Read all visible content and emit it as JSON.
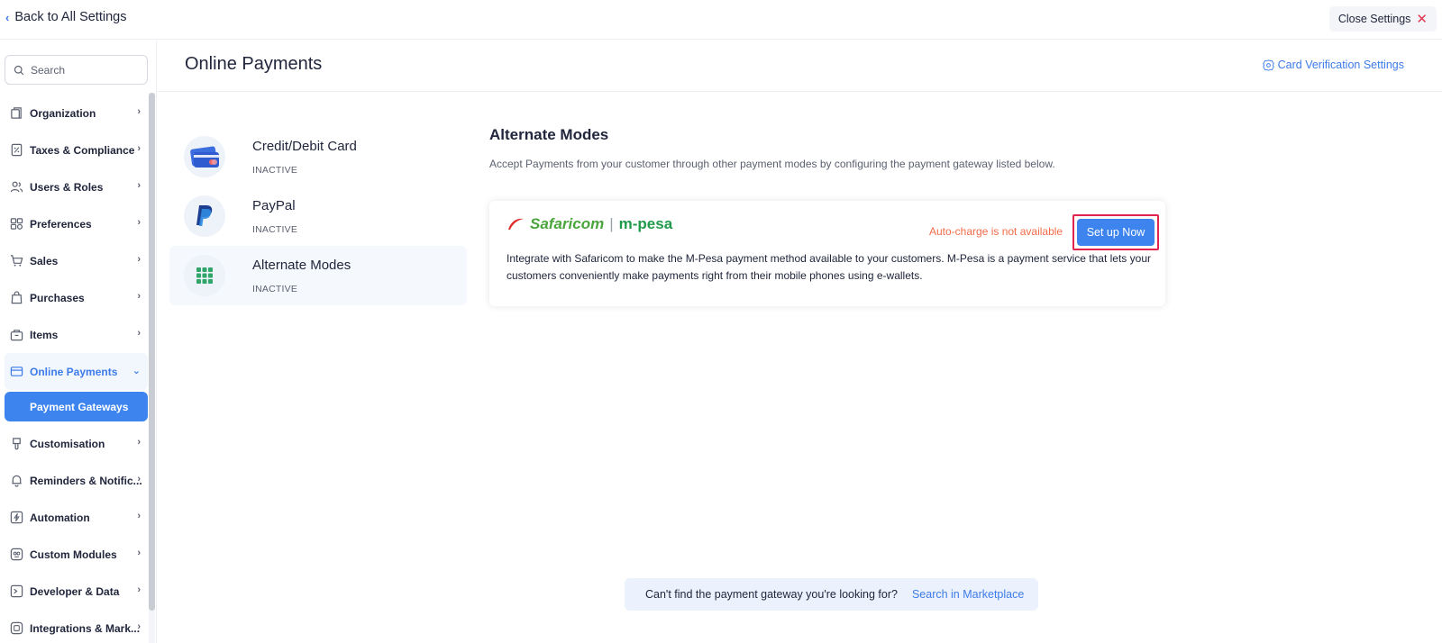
{
  "topbar": {
    "back_label": "Back to All Settings",
    "close_label": "Close Settings"
  },
  "sidebar": {
    "search_placeholder": "Search",
    "items": [
      {
        "label": "Organization",
        "icon": "building-icon"
      },
      {
        "label": "Taxes & Compliance",
        "icon": "tax-document-icon"
      },
      {
        "label": "Users & Roles",
        "icon": "users-icon"
      },
      {
        "label": "Preferences",
        "icon": "preferences-icon"
      },
      {
        "label": "Sales",
        "icon": "cart-icon"
      },
      {
        "label": "Purchases",
        "icon": "shopping-bag-icon"
      },
      {
        "label": "Items",
        "icon": "basket-icon"
      },
      {
        "label": "Online Payments",
        "icon": "card-icon",
        "active": true
      },
      {
        "label": "Customisation",
        "icon": "brush-icon"
      },
      {
        "label": "Reminders & Notific...",
        "icon": "bell-icon"
      },
      {
        "label": "Automation",
        "icon": "lightning-icon"
      },
      {
        "label": "Custom Modules",
        "icon": "custom-module-icon"
      },
      {
        "label": "Developer & Data",
        "icon": "code-icon"
      },
      {
        "label": "Integrations & Mark...",
        "icon": "integrations-icon"
      }
    ],
    "sub_item": "Payment Gateways"
  },
  "header": {
    "title": "Online Payments",
    "card_verification": "Card Verification Settings"
  },
  "modes": [
    {
      "name": "Credit/Debit Card",
      "status": "INACTIVE",
      "icon": "credit-card-icon"
    },
    {
      "name": "PayPal",
      "status": "INACTIVE",
      "icon": "paypal-icon"
    },
    {
      "name": "Alternate Modes",
      "status": "INACTIVE",
      "icon": "grid-icon",
      "active": true
    }
  ],
  "content": {
    "heading": "Alternate Modes",
    "description": "Accept Payments from your customer through other payment modes by configuring the payment gateway listed below.",
    "gateway": {
      "logo_text_1": "Safaricom",
      "logo_text_2": "m-pesa",
      "autocharge": "Auto-charge is not available",
      "setup_label": "Set up Now",
      "description": "Integrate with Safaricom to make the M-Pesa payment method available to your customers. M-Pesa is a payment service that lets your customers conveniently make payments right from their mobile phones using e-wallets."
    }
  },
  "marketplace": {
    "text": "Can't find the payment gateway you're looking for?",
    "link": "Search in Marketplace"
  },
  "colors": {
    "accent": "#3d84ee",
    "link": "#3d7be8",
    "warning": "#f26b48",
    "highlight_border": "#e3234f",
    "safaricom_green": "#4aa53c",
    "safaricom_red": "#e02b2b"
  }
}
